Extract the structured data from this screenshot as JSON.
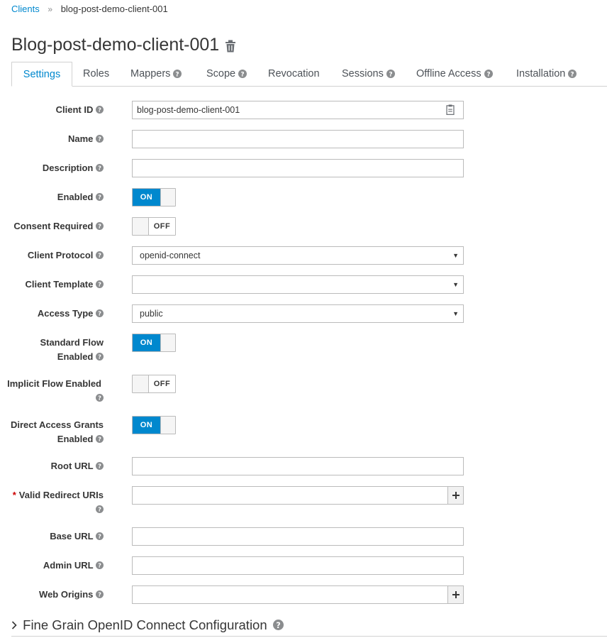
{
  "breadcrumb": {
    "parent": "Clients",
    "separator": "»",
    "current": "blog-post-demo-client-001"
  },
  "page_title": "Blog-post-demo-client-001",
  "tabs": [
    {
      "label": "Settings",
      "help": false
    },
    {
      "label": "Roles",
      "help": false
    },
    {
      "label": "Mappers",
      "help": true
    },
    {
      "label": "Scope",
      "help": true
    },
    {
      "label": "Revocation",
      "help": false
    },
    {
      "label": "Sessions",
      "help": true
    },
    {
      "label": "Offline Access",
      "help": true
    },
    {
      "label": "Installation",
      "help": true
    }
  ],
  "active_tab": "Settings",
  "form": {
    "client_id": {
      "label": "Client ID",
      "value": "blog-post-demo-client-001"
    },
    "name": {
      "label": "Name",
      "value": ""
    },
    "description": {
      "label": "Description",
      "value": ""
    },
    "enabled": {
      "label": "Enabled",
      "state": "ON"
    },
    "consent_required": {
      "label": "Consent Required",
      "state": "OFF"
    },
    "client_protocol": {
      "label": "Client Protocol",
      "value": "openid-connect"
    },
    "client_template": {
      "label": "Client Template",
      "value": ""
    },
    "access_type": {
      "label": "Access Type",
      "value": "public"
    },
    "standard_flow": {
      "label_line1": "Standard Flow",
      "label_line2": "Enabled",
      "state": "ON"
    },
    "implicit_flow": {
      "label": "Implicit Flow Enabled",
      "state": "OFF"
    },
    "direct_access": {
      "label_line1": "Direct Access Grants",
      "label_line2": "Enabled",
      "state": "ON"
    },
    "root_url": {
      "label": "Root URL",
      "value": ""
    },
    "valid_redirect_uris": {
      "required_marker": "*",
      "label": "Valid Redirect URIs",
      "value": ""
    },
    "base_url": {
      "label": "Base URL",
      "value": ""
    },
    "admin_url": {
      "label": "Admin URL",
      "value": ""
    },
    "web_origins": {
      "label": "Web Origins",
      "value": ""
    }
  },
  "sections": {
    "fine_grain": "Fine Grain OpenID Connect Configuration"
  },
  "colors": {
    "accent": "#0088ce",
    "text": "#363636",
    "required": "#cc0000",
    "border": "#bbbbbb"
  },
  "icons": {
    "help": "question-circle-icon",
    "trash": "trash-icon",
    "add": "plus-icon",
    "expand": "chevron-right-icon",
    "clipboard": "clipboard-icon"
  }
}
